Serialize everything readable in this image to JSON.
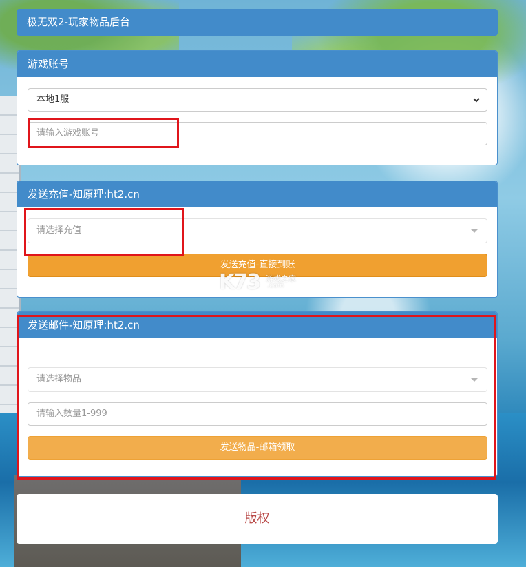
{
  "header": {
    "title": "极无双2-玩家物品后台"
  },
  "account_panel": {
    "title": "游戏账号",
    "server_select": {
      "value": "本地1服"
    },
    "account_input": {
      "placeholder": "请输入游戏账号",
      "value": ""
    }
  },
  "recharge_panel": {
    "title": "发送充值-知原理:ht2.cn",
    "recharge_select": {
      "placeholder": "请选择充值"
    },
    "send_button": {
      "label": "发送充值-直接到账"
    }
  },
  "mail_panel": {
    "title": "发送邮件-知原理:ht2.cn",
    "item_select": {
      "placeholder": "请选择物品"
    },
    "quantity_input": {
      "placeholder": "请输入数量1-999",
      "value": ""
    },
    "send_button": {
      "label": "发送物品-邮箱领取"
    }
  },
  "footer": {
    "text": "版权"
  },
  "watermark": {
    "logo": "K73",
    "site": "游戏之家",
    "domain": ".com"
  },
  "colors": {
    "primary": "#428bca",
    "button": "#f0a030",
    "highlight": "#e0151b",
    "footer_text": "#b94a48"
  }
}
